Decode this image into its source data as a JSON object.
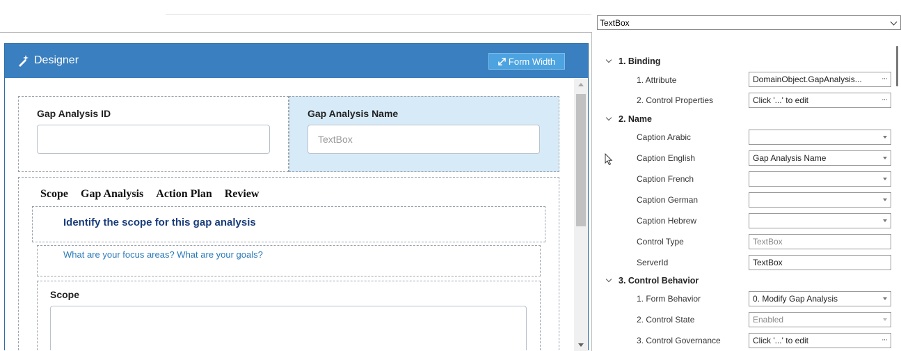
{
  "designer": {
    "title": "Designer",
    "form_width_button": "Form Width",
    "fields": {
      "gap_analysis_id_label": "Gap Analysis ID",
      "gap_analysis_id_value": "",
      "gap_analysis_name_label": "Gap Analysis Name",
      "gap_analysis_name_placeholder": "TextBox"
    },
    "tabs": [
      "Scope",
      "Gap Analysis",
      "Action Plan",
      "Review"
    ],
    "scope_heading": "Identify the scope for this gap analysis",
    "scope_info": "What are your focus areas? What are your goals?",
    "scope_label": "Scope"
  },
  "property_grid": {
    "control_type_selector": "TextBox",
    "categories": [
      {
        "name": "1. Binding",
        "properties": [
          {
            "name": "1. Attribute",
            "value": "DomainObject.GapAnalysis...",
            "editor": "ellipsis"
          },
          {
            "name": "2. Control Properties",
            "value": "Click '...' to edit",
            "editor": "ellipsis"
          }
        ]
      },
      {
        "name": "2. Name",
        "properties": [
          {
            "name": "Caption Arabic",
            "value": "",
            "editor": "dropdown"
          },
          {
            "name": "Caption English",
            "value": "Gap Analysis Name",
            "editor": "dropdown"
          },
          {
            "name": "Caption French",
            "value": "",
            "editor": "dropdown"
          },
          {
            "name": "Caption German",
            "value": "",
            "editor": "dropdown"
          },
          {
            "name": "Caption Hebrew",
            "value": "",
            "editor": "dropdown"
          },
          {
            "name": "Control Type",
            "value": "TextBox",
            "editor": "readonly"
          },
          {
            "name": "ServerId",
            "value": "TextBox",
            "editor": "text"
          }
        ]
      },
      {
        "name": "3. Control Behavior",
        "properties": [
          {
            "name": "1. Form Behavior",
            "value": "0. Modify Gap Analysis",
            "editor": "dropdown"
          },
          {
            "name": "2. Control State",
            "value": "Enabled",
            "editor": "dropdown-disabled"
          },
          {
            "name": "3. Control Governance",
            "value": "Click '...' to edit",
            "editor": "ellipsis"
          }
        ]
      }
    ]
  },
  "colors": {
    "header_blue": "#3a7fbf",
    "button_blue": "#4da3e0",
    "selected_cell": "#d7eaf8",
    "heading_navy": "#1a3d7a",
    "info_blue": "#2a7ab8"
  },
  "icons": [
    "designer-wand-icon",
    "resize-arrows-icon",
    "dropdown-chevron-icon",
    "mouse-pointer-icon"
  ]
}
